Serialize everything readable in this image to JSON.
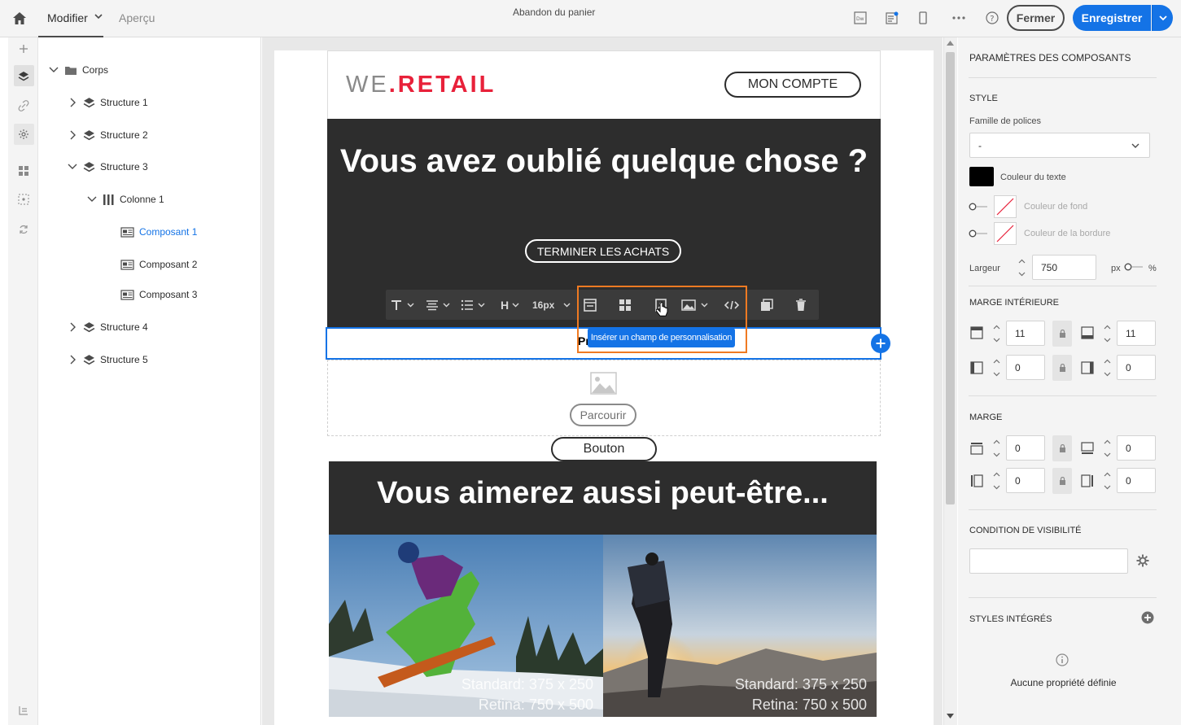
{
  "header": {
    "tab_modifier": "Modifier",
    "tab_apercu": "Aperçu",
    "title": "Abandon du panier",
    "btn_fermer": "Fermer",
    "btn_enregistrer": "Enregistrer"
  },
  "tree": {
    "root": "Corps",
    "items": [
      "Structure 1",
      "Structure 2",
      "Structure 3",
      "Colonne 1",
      "Composant 1",
      "Composant 2",
      "Composant 3",
      "Structure 4",
      "Structure 5"
    ]
  },
  "email": {
    "logo_we": "WE",
    "logo_dot": ".",
    "logo_retail": "RETAIL",
    "btn_compte": "MON COMPTE",
    "hero_title": "Vous avez oublié quelque chose ?",
    "btn_terminer": "TERMINER LES ACHATS",
    "toolbar_size": "16px",
    "toolbar_heading": "H",
    "tooltip": "Insérer un champ de personnalisation",
    "text_fragment": "Pr",
    "btn_parcourir": "Parcourir",
    "btn_bouton": "Bouton",
    "banner2_title": "Vous aimerez aussi peut-être...",
    "photo1_cap1": "Standard: 375 x 250",
    "photo1_cap2": "Retina: 750 x 500",
    "photo2_cap1": "Standard: 375 x 250",
    "photo2_cap2": "Retina: 750 x 500"
  },
  "panel": {
    "title": "PARAMÈTRES DES COMPOSANTS",
    "style": "STYLE",
    "font_family_label": "Famille de polices",
    "font_family_value": "-",
    "text_color_label": "Couleur du texte",
    "bg_color_label": "Couleur de fond",
    "border_color_label": "Couleur de la bordure",
    "width_label": "Largeur",
    "width_value": "750",
    "unit_px": "px",
    "unit_pct": "%",
    "inner_margin": "MARGE INTÉRIEURE",
    "inner_top": "11",
    "inner_bottom": "11",
    "inner_left": "0",
    "inner_right": "0",
    "margin": "MARGE",
    "margin_top": "0",
    "margin_bottom": "0",
    "margin_left": "0",
    "margin_right": "0",
    "visibility": "CONDITION DE VISIBILITÉ",
    "integrated_styles": "STYLES INTÉGRÉS",
    "no_props": "Aucune propriété définie"
  },
  "colors": {
    "accent": "#1473e6",
    "highlight": "#ef7a22",
    "brand_red": "#e8213a",
    "text_color_swatch": "#000000"
  }
}
